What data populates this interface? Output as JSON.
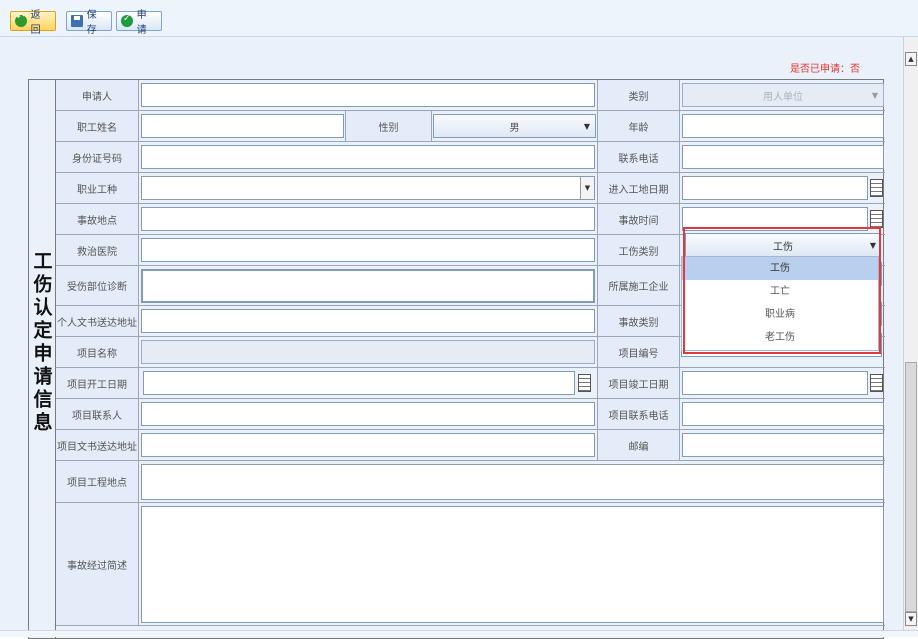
{
  "toolbar": {
    "back_label": "返回",
    "save_label": "保存",
    "apply_label": "申请"
  },
  "status_text": "是否已申请：否",
  "side_title": "工伤认定申请信息",
  "labels": {
    "applicant": "申请人",
    "category": "类别",
    "worker_name": "职工姓名",
    "gender": "性别",
    "age": "年龄",
    "id_number": "身份证号码",
    "phone": "联系电话",
    "job_type": "职业工种",
    "entry_date": "进入工地日期",
    "accident_place": "事故地点",
    "accident_time": "事故时间",
    "hospital": "救治医院",
    "injury_type": "工伤类别",
    "injury_diagnosis": "受伤部位诊断",
    "contractor": "所属施工企业",
    "personal_address": "个人文书送达地址",
    "accident_category": "事故类别",
    "project_name": "项目名称",
    "project_no": "项目编号",
    "project_start": "项目开工日期",
    "project_end": "项目竣工日期",
    "project_contact": "项目联系人",
    "project_contact_phone": "项目联系电话",
    "project_address": "项目文书送达地址",
    "postcode": "邮编",
    "project_site": "项目工程地点",
    "accident_desc": "事故经过简述"
  },
  "values": {
    "category": "用人单位",
    "gender": "男",
    "injury_type": "工伤"
  },
  "injury_type_options": [
    "工伤",
    "工亡",
    "职业病",
    "老工伤"
  ],
  "selected_option_index": 0,
  "colors": {
    "status": "#e5322d",
    "highlight": "#e0393e",
    "selected_option": "#b9cfee"
  }
}
